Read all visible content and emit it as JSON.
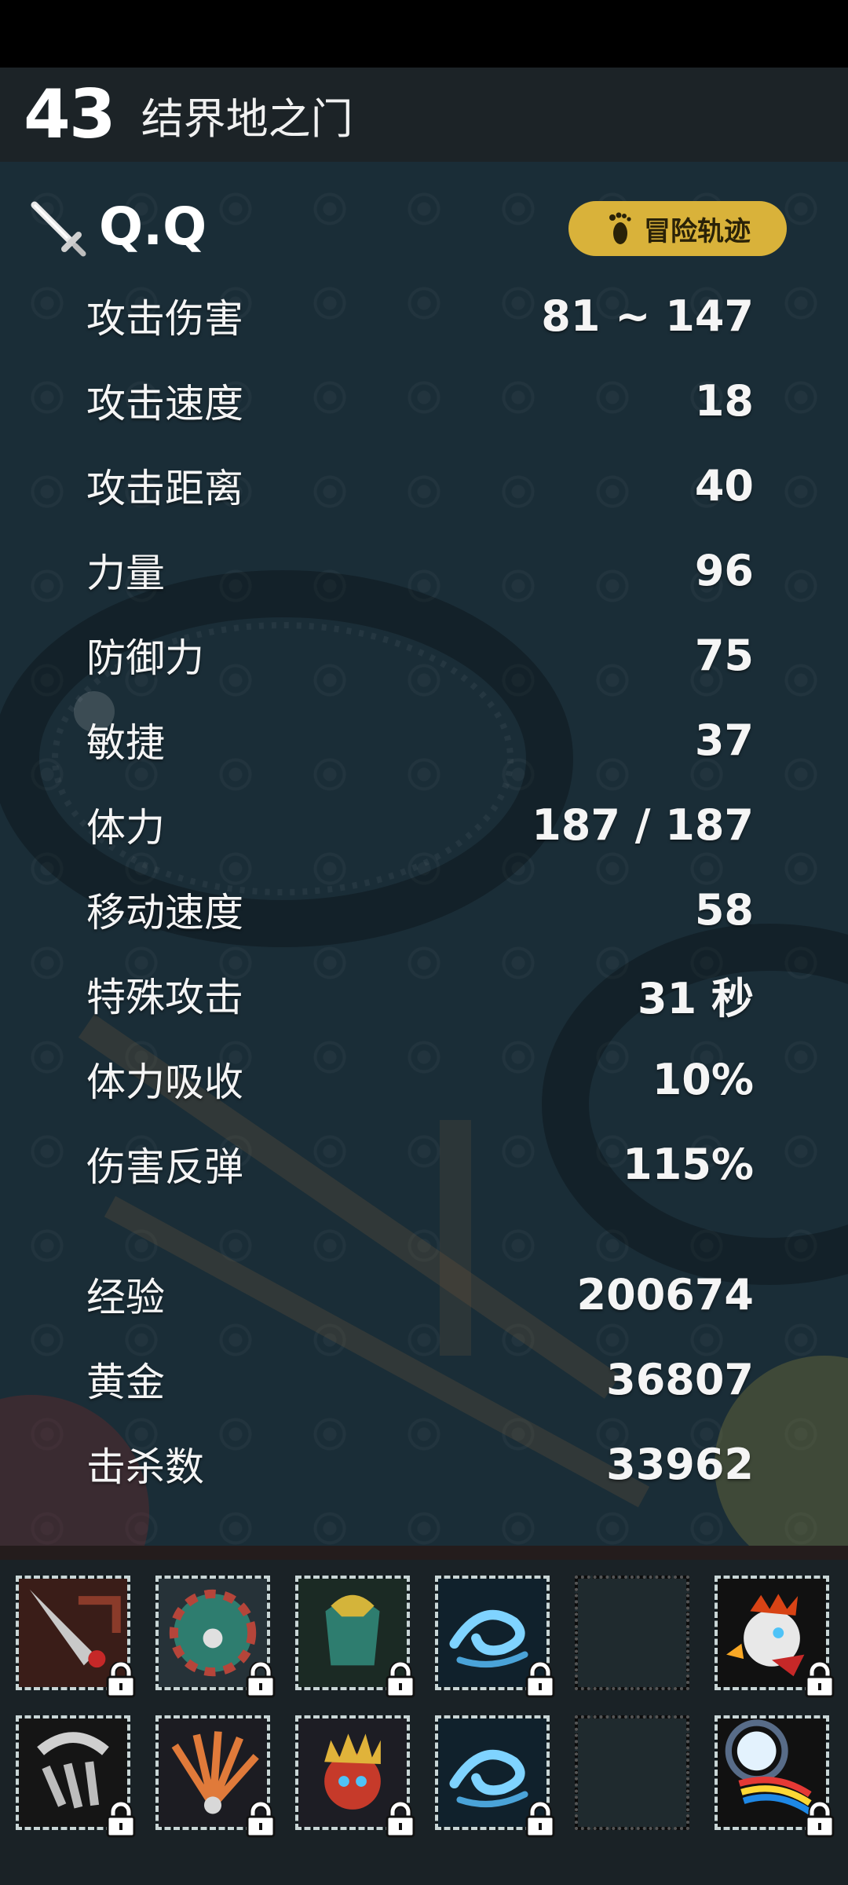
{
  "level": {
    "number": "43",
    "title": "结界地之门"
  },
  "player": {
    "name": "Q.Q",
    "trail_button_label": "冒险轨迹"
  },
  "stats": [
    {
      "label": "攻击伤害",
      "value": "81 ~ 147"
    },
    {
      "label": "攻击速度",
      "value": "18"
    },
    {
      "label": "攻击距离",
      "value": "40"
    },
    {
      "label": "力量",
      "value": "96"
    },
    {
      "label": "防御力",
      "value": "75"
    },
    {
      "label": "敏捷",
      "value": "37"
    },
    {
      "label": "体力",
      "value": "187 / 187"
    },
    {
      "label": "移动速度",
      "value": "58"
    },
    {
      "label": "特殊攻击",
      "value": "31 秒"
    },
    {
      "label": "体力吸收",
      "value": "10%"
    },
    {
      "label": "伤害反弹",
      "value": "115%"
    }
  ],
  "totals": [
    {
      "label": "经验",
      "value": "200674"
    },
    {
      "label": "黄金",
      "value": "36807"
    },
    {
      "label": "击杀数",
      "value": "33962"
    }
  ],
  "skill_slots": [
    {
      "icon": "spear-skill-icon",
      "locked": true
    },
    {
      "icon": "shield-skill-icon",
      "locked": true
    },
    {
      "icon": "armor-skill-icon",
      "locked": true
    },
    {
      "icon": "wind-skill-icon",
      "locked": true
    },
    {
      "icon": "empty-slot",
      "locked": false
    },
    {
      "icon": "rooster-skill-icon",
      "locked": true
    },
    {
      "icon": "claw-skill-icon",
      "locked": true
    },
    {
      "icon": "fan-skill-icon",
      "locked": true
    },
    {
      "icon": "spiked-beast-skill-icon",
      "locked": true
    },
    {
      "icon": "wind-skill-icon",
      "locked": true
    },
    {
      "icon": "empty-slot",
      "locked": false
    },
    {
      "icon": "rainbow-orb-skill-icon",
      "locked": true
    }
  ],
  "colors": {
    "panel_bg": "#1a2d37",
    "header_bg": "#1c2327",
    "trail_button": "#d9b23a",
    "skill_area_bg": "#1a2226"
  }
}
